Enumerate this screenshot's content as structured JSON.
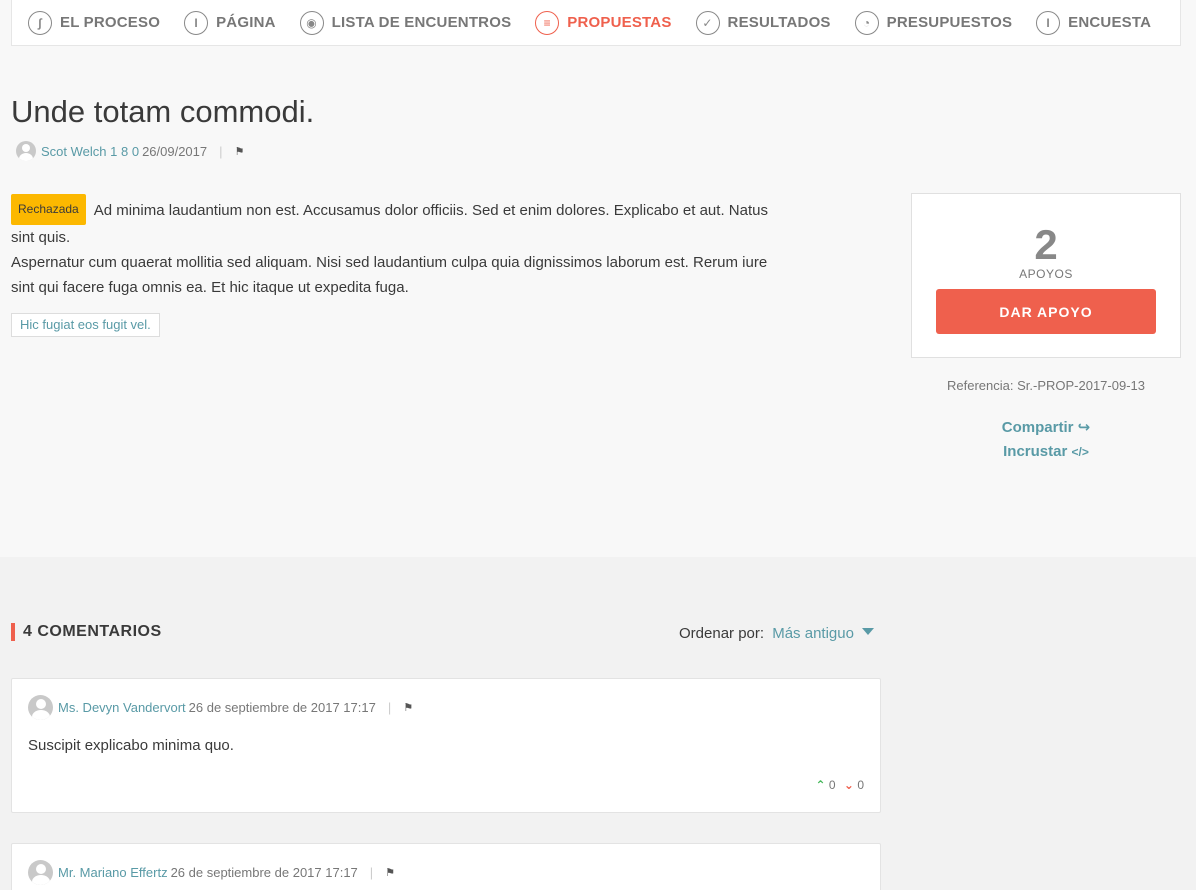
{
  "tabs": [
    {
      "label": "EL PROCESO",
      "icon": "process-icon",
      "glyph": "∫"
    },
    {
      "label": "PÁGINA",
      "icon": "info-icon",
      "glyph": "i"
    },
    {
      "label": "LISTA DE ENCUENTROS",
      "icon": "location-pin-icon",
      "glyph": "◉"
    },
    {
      "label": "PROPUESTAS",
      "icon": "list-icon",
      "glyph": "≡",
      "active": true
    },
    {
      "label": "RESULTADOS",
      "icon": "check-icon",
      "glyph": "✓"
    },
    {
      "label": "PRESUPUESTOS",
      "icon": "pie-chart-icon",
      "glyph": "◔"
    },
    {
      "label": "ENCUESTA",
      "icon": "info-icon",
      "glyph": "i"
    }
  ],
  "proposal": {
    "title": "Unde totam commodi.",
    "author": "Scot Welch",
    "author_counts": "1 8 0",
    "date": "26/09/2017",
    "status": "Rechazada",
    "body_line1": "Ad minima laudantium non est. Accusamus dolor officiis. Sed et enim dolores. Explicabo et aut. Natus sint quis.",
    "body_line2": "Aspernatur cum quaerat mollitia sed aliquam. Nisi sed laudantium culpa quia dignissimos laborum est. Rerum iure sint qui facere fuga omnis ea. Et hic itaque ut expedita fuga.",
    "tag": "Hic fugiat eos fugit vel."
  },
  "support": {
    "count": "2",
    "label": "APOYOS",
    "button": "DAR APOYO",
    "reference": "Referencia: Sr.-PROP-2017-09-13",
    "share": "Compartir",
    "embed": "Incrustar"
  },
  "comments_section": {
    "title": "4 COMENTARIOS",
    "order_label": "Ordenar por:",
    "order_value": "Más antiguo"
  },
  "comments": [
    {
      "author": "Ms. Devyn Vandervort",
      "date": "26 de septiembre de 2017 17:17",
      "body": "Suscipit explicabo minima quo.",
      "up": "0",
      "down": "0"
    },
    {
      "author": "Mr. Mariano Effertz",
      "date": "26 de septiembre de 2017 17:17",
      "body": "",
      "up": "",
      "down": ""
    }
  ],
  "colors": {
    "accent": "#ef604d",
    "link": "#599aa6",
    "badge": "#fcb800"
  }
}
